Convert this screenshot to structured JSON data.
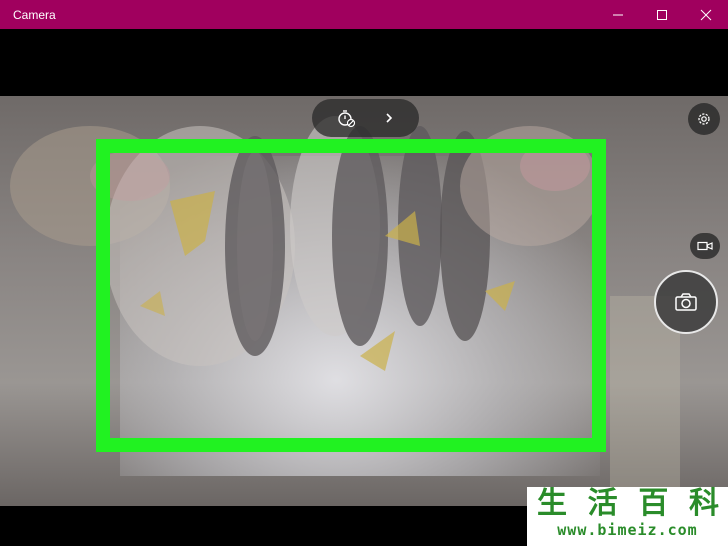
{
  "window": {
    "title": "Camera",
    "controls": [
      "minimize",
      "maximize",
      "close"
    ]
  },
  "toolbar": {
    "timer_icon": "timer-off-icon",
    "expand_icon": "chevron-right-icon"
  },
  "side_controls": {
    "settings_icon": "gear-icon",
    "video_mode_icon": "video-camera-icon",
    "shutter_icon": "camera-icon"
  },
  "highlight": {
    "color": "#21f221"
  },
  "colors": {
    "titlebar": "#a0005e",
    "watermark_text": "#2a8c2a"
  },
  "watermark": {
    "chars": [
      "生",
      "活",
      "百",
      "科"
    ],
    "url": "www.bimeiz.com"
  }
}
